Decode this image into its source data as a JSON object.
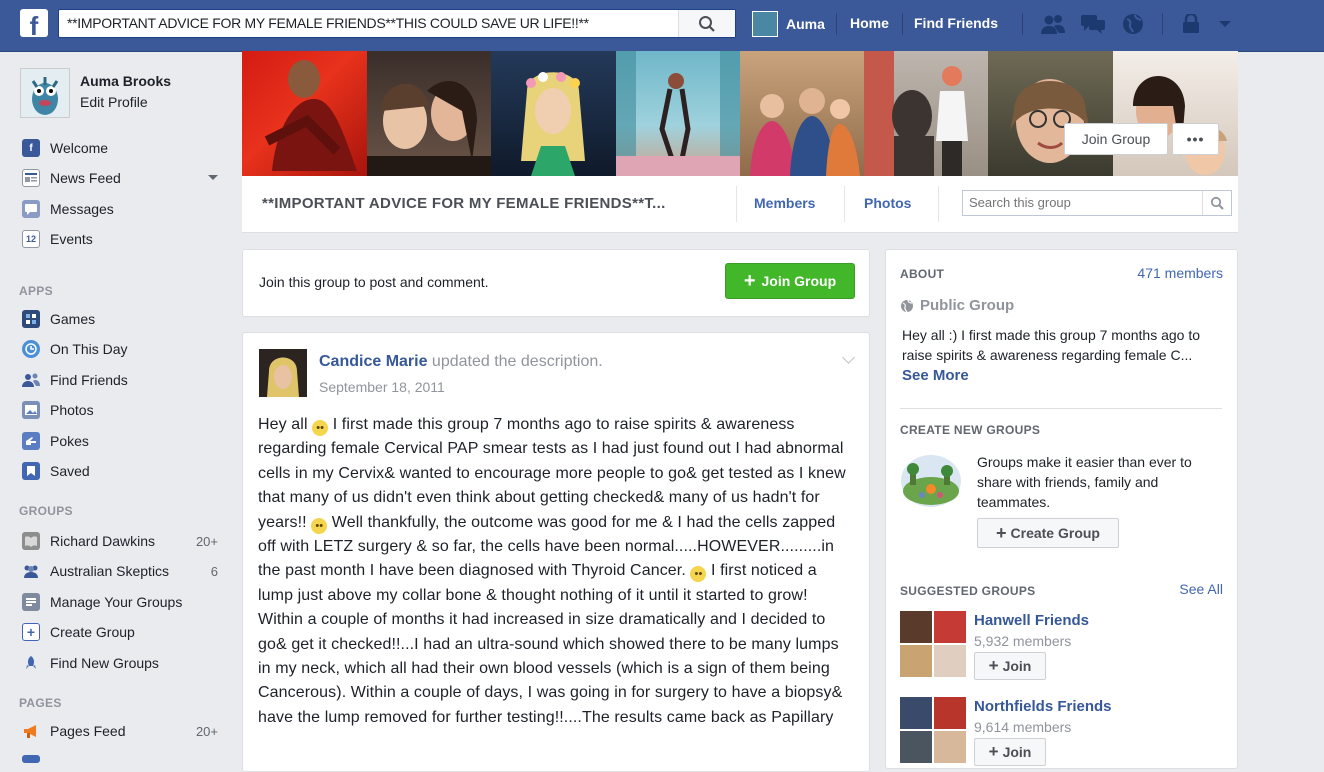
{
  "topbar": {
    "search_value": "**IMPORTANT ADVICE FOR MY FEMALE FRIENDS**THIS COULD SAVE UR LIFE!!**",
    "user_name": "Auma",
    "home": "Home",
    "find_friends": "Find Friends"
  },
  "profile": {
    "name": "Auma Brooks",
    "edit": "Edit Profile"
  },
  "sidebar": {
    "favorites": [
      {
        "label": "Welcome"
      },
      {
        "label": "News Feed"
      },
      {
        "label": "Messages"
      },
      {
        "label": "Events",
        "icon_text": "12"
      }
    ],
    "apps_header": "APPS",
    "apps": [
      {
        "label": "Games"
      },
      {
        "label": "On This Day"
      },
      {
        "label": "Find Friends"
      },
      {
        "label": "Photos"
      },
      {
        "label": "Pokes"
      },
      {
        "label": "Saved"
      }
    ],
    "groups_header": "GROUPS",
    "groups": [
      {
        "label": "Richard Dawkins",
        "count": "20+"
      },
      {
        "label": "Australian Skeptics",
        "count": "6"
      },
      {
        "label": "Manage Your Groups",
        "count": ""
      },
      {
        "label": "Create Group",
        "count": ""
      },
      {
        "label": "Find New Groups",
        "count": ""
      }
    ],
    "pages_header": "PAGES",
    "pages": [
      {
        "label": "Pages Feed",
        "count": "20+"
      }
    ]
  },
  "cover": {
    "join_label": "Join Group",
    "more_label": "•••"
  },
  "groupbar": {
    "title": "**IMPORTANT ADVICE FOR MY FEMALE FRIENDS**T...",
    "tab_members": "Members",
    "tab_photos": "Photos",
    "search_placeholder": "Search this group"
  },
  "join_card": {
    "prompt": "Join this group to post and comment.",
    "button": "Join Group"
  },
  "post": {
    "author": "Candice Marie",
    "action": " updated the description.",
    "date": "September 18, 2011",
    "body_1": "Hey all ",
    "body_2": " I first made this group 7 months ago to raise spirits & awareness regarding female Cervical PAP smear tests as I had just found out I had abnormal cells in my Cervix& wanted to encourage more people to go& get tested as I knew that many of us didn't even think about getting checked& many of us hadn't for years!! ",
    "body_3": " Well thankfully, the outcome was good for me & I had the cells zapped off with LETZ surgery & so far, the cells have been normal.....HOWEVER.........in the past month I have been diagnosed with Thyroid Cancer. ",
    "body_4": " I first noticed a lump just above my collar bone & thought nothing of it until it started to grow! Within a couple of months it had increased in size dramatically and I decided to go& get it checked!!...I had an ultra-sound which showed there to be many lumps in my neck, which all had their own blood vessels (which is a sign of them being Cancerous). Within a couple of days, I was going in for surgery to have a biopsy& have the lump removed for further testing!!....The results came back as Papillary"
  },
  "about": {
    "header": "ABOUT",
    "members": "471 members",
    "privacy": "Public Group",
    "description": "Hey all :) I first made this group 7 months ago to raise spirits & awareness regarding female C...",
    "see_more": "See More"
  },
  "create_groups": {
    "header": "CREATE NEW GROUPS",
    "text": "Groups make it easier than ever to share with friends, family and teammates.",
    "button": "Create Group"
  },
  "suggested": {
    "header": "SUGGESTED GROUPS",
    "see_all": "See All",
    "groups": [
      {
        "name": "Hanwell Friends",
        "members": "5,932 members",
        "button": "Join"
      },
      {
        "name": "Northfields Friends",
        "members": "9,614 members",
        "button": "Join"
      }
    ]
  },
  "colors": {
    "brand": "#3b5998",
    "link": "#4267b2",
    "green": "#42b72a"
  }
}
